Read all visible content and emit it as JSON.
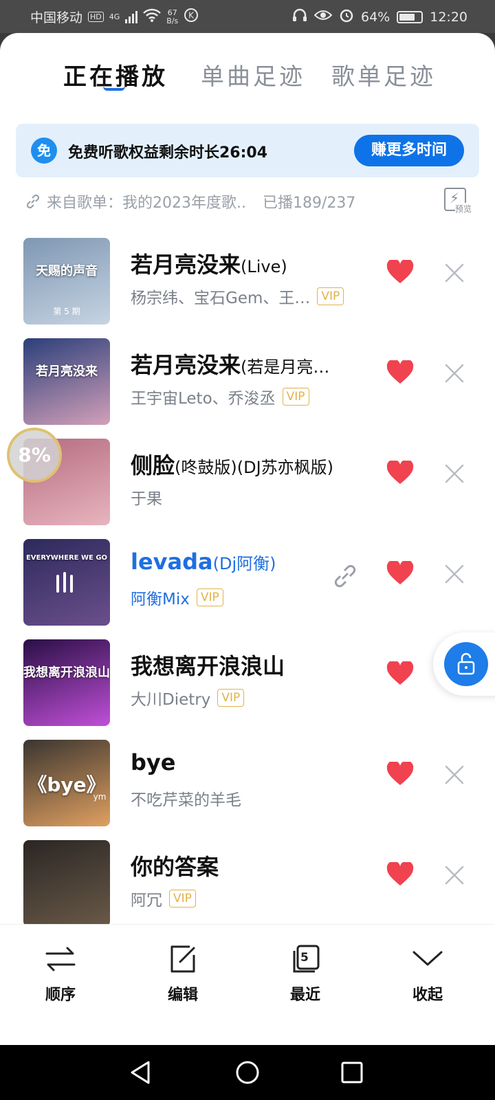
{
  "status_bar": {
    "carrier": "中国移动",
    "hd": "HD",
    "network": "4G",
    "speed_value": "67",
    "speed_unit": "B/s",
    "battery": "64%",
    "time": "12:20"
  },
  "tabs": [
    {
      "label": "正在播放",
      "active": true
    },
    {
      "label": "单曲足迹",
      "active": false
    },
    {
      "label": "歌单足迹",
      "active": false
    }
  ],
  "banner": {
    "icon_text": "免",
    "text": "免费听歌权益剩余时长26:04",
    "button": "赚更多时间"
  },
  "source": {
    "label": "来自歌单：我的2023年度歌..",
    "played": "已播189/237",
    "preview_label": "预览"
  },
  "songs": [
    {
      "title": "若月亮没来",
      "suffix": "(Live)",
      "artist": "杨宗纬、宝石Gem、王…",
      "vip": "VIP",
      "liked": true,
      "playing": false,
      "cover_colors": [
        "#7f97b3",
        "#c6d4e2"
      ]
    },
    {
      "title": "若月亮没来",
      "suffix": "(若是月亮…",
      "artist": "王宇宙Leto、乔浚丞",
      "vip": "VIP",
      "liked": true,
      "playing": false,
      "cover_colors": [
        "#2b3f7a",
        "#d2a0b8"
      ]
    },
    {
      "title": "侧脸",
      "suffix": "(咚鼓版)(DJ苏亦枫版)",
      "artist": "于果",
      "vip": "",
      "liked": true,
      "playing": false,
      "cover_colors": [
        "#b46c80",
        "#e8b4be"
      ]
    },
    {
      "title": "levada",
      "suffix": "(Dj阿衡)",
      "artist": "阿衡Mix",
      "vip": "VIP",
      "liked": true,
      "playing": true,
      "cover_colors": [
        "#2d2a5c",
        "#6b4f8c"
      ]
    },
    {
      "title": "我想离开浪浪山",
      "suffix": "",
      "artist": "大川Dietry",
      "vip": "VIP",
      "liked": true,
      "playing": false,
      "cover_colors": [
        "#2a0f45",
        "#c050d8"
      ]
    },
    {
      "title": "bye",
      "suffix": "",
      "artist": "不吃芹菜的羊毛",
      "vip": "",
      "liked": true,
      "playing": false,
      "cover_colors": [
        "#3a3530",
        "#e0a060"
      ]
    },
    {
      "title": "你的答案",
      "suffix": "",
      "artist": "阿冗",
      "vip": "VIP",
      "liked": true,
      "playing": false,
      "cover_colors": [
        "#2a2624",
        "#6a5a48"
      ]
    }
  ],
  "cover_texts": {
    "c0_main": "天赐的声音",
    "c0_sub": "第 5 期",
    "c1_main": "若月亮没来",
    "c3_main": "EVERYWHERE WE GO",
    "c4_main": "我想离开浪浪山",
    "c5_main": "《bye》",
    "c5_sub": "ym"
  },
  "floating": {
    "progress": "8%"
  },
  "bottom_bar": {
    "order": "顺序",
    "edit": "编辑",
    "recent": "最近",
    "recent_count": "5",
    "collapse": "收起"
  },
  "colors": {
    "accent": "#1f6fe0",
    "heart": "#f0424f",
    "vip": "#e2b24a"
  }
}
